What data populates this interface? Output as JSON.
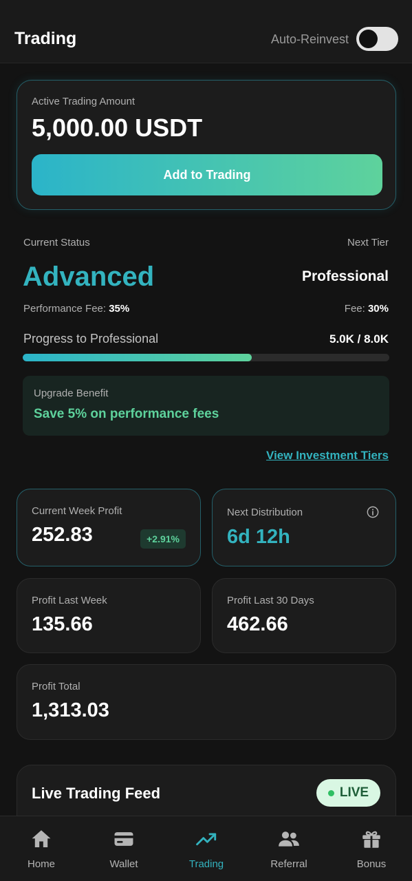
{
  "header": {
    "title": "Trading",
    "auto_reinvest_label": "Auto-Reinvest",
    "auto_reinvest_on": false
  },
  "active_trading": {
    "label": "Active Trading Amount",
    "amount": "5,000.00 USDT",
    "button_label": "Add to Trading"
  },
  "status": {
    "current_label": "Current Status",
    "current_value": "Advanced",
    "next_label": "Next Tier",
    "next_value": "Professional",
    "fee_label": "Performance Fee: ",
    "fee_value": "35%",
    "next_fee_label": "Fee: ",
    "next_fee_value": "30%",
    "progress_label": "Progress to Professional",
    "progress_value": "5.0K / 8.0K",
    "progress_fraction": 0.625
  },
  "benefit": {
    "label": "Upgrade Benefit",
    "value": "Save 5% on performance fees"
  },
  "tiers_link": "View Investment Tiers",
  "stats": {
    "current_week": {
      "label": "Current Week Profit",
      "value": "252.83",
      "badge": "+2.91%"
    },
    "next_distribution": {
      "label": "Next Distribution",
      "value": "6d 12h"
    },
    "last_week": {
      "label": "Profit Last Week",
      "value": "135.66"
    },
    "last_30": {
      "label": "Profit Last 30 Days",
      "value": "462.66"
    },
    "total": {
      "label": "Profit Total",
      "value": "1,313.03"
    }
  },
  "feed": {
    "title": "Live Trading Feed",
    "live_label": "LIVE"
  },
  "nav": {
    "items": [
      {
        "label": "Home",
        "icon": "home-icon"
      },
      {
        "label": "Wallet",
        "icon": "wallet-icon"
      },
      {
        "label": "Trading",
        "icon": "trending-up-icon"
      },
      {
        "label": "Referral",
        "icon": "users-icon"
      },
      {
        "label": "Bonus",
        "icon": "gift-icon"
      }
    ],
    "active": "Trading"
  },
  "colors": {
    "accent": "#33b3bf",
    "green": "#5ed29c",
    "background": "#131313",
    "card": "#1c1c1c"
  }
}
